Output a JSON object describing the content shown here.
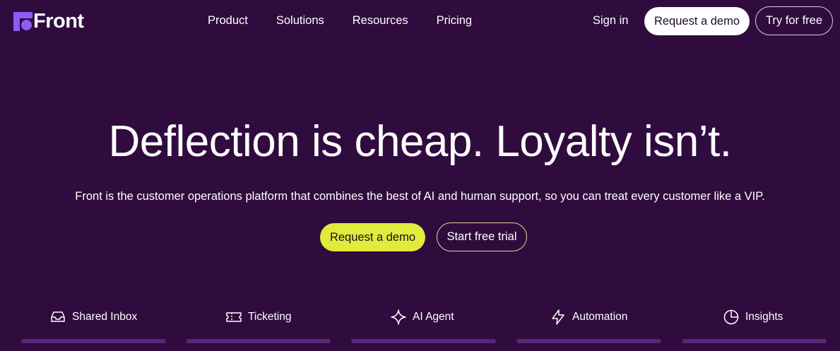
{
  "brand": {
    "name": "Front",
    "logo_color": "#8b5cf6",
    "background": "#300c3e"
  },
  "nav": {
    "items": [
      {
        "label": "Product"
      },
      {
        "label": "Solutions"
      },
      {
        "label": "Resources"
      },
      {
        "label": "Pricing"
      }
    ],
    "sign_in": "Sign in",
    "request_demo": "Request a demo",
    "try_free": "Try for free"
  },
  "hero": {
    "title": "Deflection is cheap. Loyalty isn’t.",
    "subtitle": "Front is the customer operations platform that combines the best of AI and human support, so you can treat every customer like a VIP.",
    "primary_cta": "Request a demo",
    "secondary_cta": "Start free trial",
    "accent": "#e1eb3b"
  },
  "tabs": [
    {
      "label": "Shared Inbox",
      "icon": "inbox-icon",
      "selected": true
    },
    {
      "label": "Ticketing",
      "icon": "ticket-icon",
      "selected": false
    },
    {
      "label": "AI Agent",
      "icon": "sparkle-icon",
      "selected": false
    },
    {
      "label": "Automation",
      "icon": "lightning-icon",
      "selected": false
    },
    {
      "label": "Insights",
      "icon": "pie-chart-icon",
      "selected": false
    }
  ]
}
